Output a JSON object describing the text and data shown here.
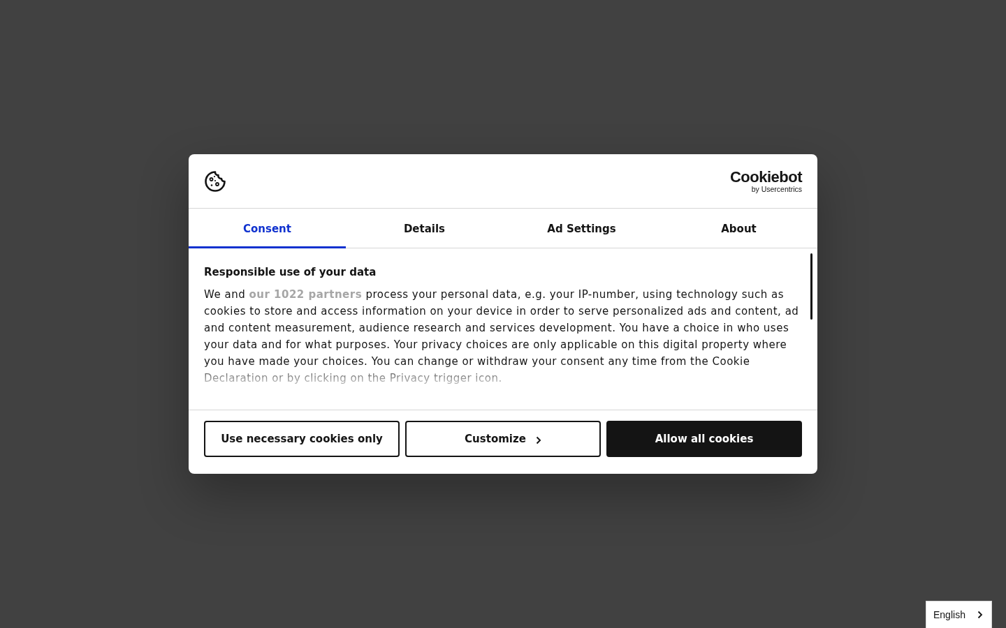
{
  "dialog": {
    "logo": {
      "name": "Cookiebot",
      "tagline": "by Usercentrics"
    },
    "tabs": [
      {
        "label": "Consent",
        "selected": true
      },
      {
        "label": "Details",
        "selected": false
      },
      {
        "label": "Ad Settings",
        "selected": false
      },
      {
        "label": "About",
        "selected": false
      }
    ],
    "heading": "Responsible use of your data",
    "body": {
      "before": "We and",
      "link": "our 1022 partners",
      "after": "process your personal data, e.g. your IP-number, using technology such as cookies to store and access information on your device in order to serve personalized ads and content, ad and content measurement, audience research and services development. You have a choice in who uses your data and for what purposes. Your privacy choices are only applicable on this digital property where you have made your choices. You can change or withdraw your consent any time from the Cookie Declaration or by clicking on the Privacy trigger icon."
    },
    "buttons": [
      {
        "label": "Use necessary cookies only",
        "kind": "outline"
      },
      {
        "label": "Customize",
        "kind": "outline-next"
      },
      {
        "label": "Allow all cookies",
        "kind": "primary"
      }
    ]
  },
  "language": {
    "label": "English"
  }
}
